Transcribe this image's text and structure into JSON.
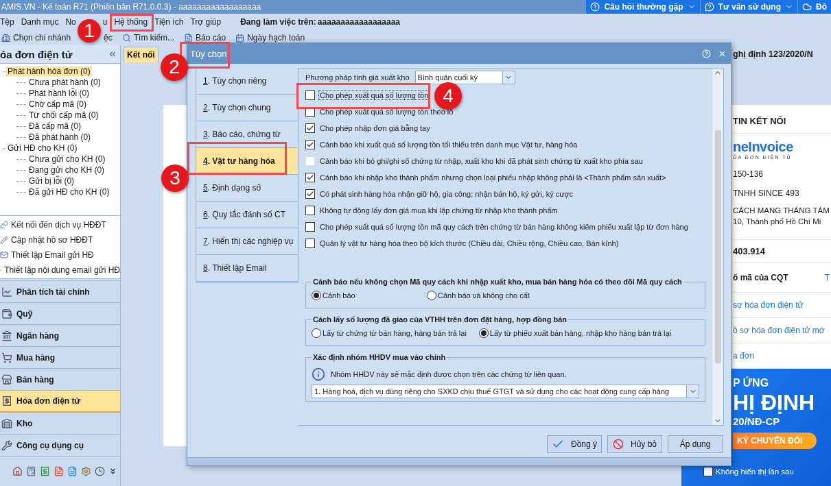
{
  "window": {
    "title": "AMIS.VN - Kế toán R71 (Phiên bản R71.0.0.3) - aaaaaaaaaaaaaaaaaa",
    "help_buttons": [
      {
        "label": "Câu hỏi thường gặp"
      },
      {
        "label": "Tư vấn sử dụng"
      },
      {
        "label": "Đô"
      }
    ]
  },
  "menu": {
    "items": [
      "Tệp",
      "Danh mục",
      "No",
      "u",
      "Hệ thống",
      "Tiện ích",
      "Trợ giúp"
    ],
    "workspace_label": "Đang làm việc trên:",
    "workspace": "aaaaaaaaaaaaaaaaaa"
  },
  "toolbar": [
    {
      "label": "Chọn chi nhánh"
    },
    {
      "label": "ệc"
    },
    {
      "label": "Tìm kiếm..."
    },
    {
      "label": "Báo cáo"
    },
    {
      "label": "Ngày hạch toán"
    }
  ],
  "sidebar": {
    "title": "óa đơn điện tử",
    "tree": [
      {
        "label": "Phát hành hóa đơn (0)",
        "selected": true,
        "children": [
          {
            "label": "Chưa phát hành (0)",
            "selected": false
          },
          {
            "label": "Phát hành lỗi (0)",
            "selected": false
          },
          {
            "label": "Chờ cấp mã (0)",
            "selected": false
          },
          {
            "label": "Từ chối cấp mã (0)",
            "selected": false
          },
          {
            "label": "Đã cấp mã (0)",
            "selected": false
          },
          {
            "label": "Đã phát hành (0)",
            "selected": false
          }
        ]
      },
      {
        "label": "Gửi HĐ cho KH (0)",
        "selected": false,
        "children": [
          {
            "label": "Chưa gửi cho KH (0)",
            "selected": false
          },
          {
            "label": "Đang gửi cho KH (0)",
            "selected": false
          },
          {
            "label": "Gửi bị lỗi (0)",
            "selected": false
          },
          {
            "label": "Đã gửi HĐ cho KH (0)",
            "selected": false
          }
        ]
      }
    ],
    "links": [
      "Kết nối đến dịch vụ HĐĐT",
      "Cập nhật hồ sơ HĐĐT",
      "Thiết lập Email gửi HĐ",
      "Thiết lập nội dung email gửi HĐ"
    ],
    "modules": [
      {
        "label": "Phân tích tài chính",
        "selected": false
      },
      {
        "label": "Quỹ",
        "selected": false
      },
      {
        "label": "Ngân hàng",
        "selected": false
      },
      {
        "label": "Mua hàng",
        "selected": false
      },
      {
        "label": "Bán hàng",
        "selected": false
      },
      {
        "label": "Hóa đơn điện tử",
        "selected": true
      },
      {
        "label": "Kho",
        "selected": false
      },
      {
        "label": "Công cụ dụng cụ",
        "selected": false
      }
    ]
  },
  "tab": {
    "label": "Kết nối",
    "selected": true
  },
  "connection_panel": {
    "heading": "ghị định 123/2020/N",
    "title": "TIN KẾT NỐI",
    "logo": "neInvoice",
    "logo_tagline": "ÓA ĐƠN ĐIỆN TỬ",
    "fields": [
      "150-136",
      "TNHH SINCE 493"
    ],
    "address_lines": [
      "CÁCH MẠNG THÁNG TÁM",
      "10, Thành phố Hồ Chí Mi"
    ],
    "amount": "403.914",
    "status_row": {
      "label": "ố mã của CQT",
      "link": "T"
    },
    "links": [
      "sơ hóa đơn điện tử",
      "ồ sơ hóa đơn điện tử mớ",
      "a đơn"
    ],
    "banner": {
      "lines": [
        "P ỨNG",
        "HỊ ĐỊNH",
        "20/NĐ-CP"
      ],
      "button": "KÝ CHUYỂN ĐỔI",
      "checkbox": {
        "label": "Không hiển thị lần sau",
        "checked": false
      }
    }
  },
  "dialog": {
    "title": "Tùy chọn",
    "nav": [
      {
        "label": "1. Tùy chọn riêng",
        "selected": false
      },
      {
        "label": "2. Tùy chọn chung",
        "selected": false
      },
      {
        "label": "3. Báo cáo, chứng từ",
        "selected": false
      },
      {
        "label": "4. Vật tư hàng hóa",
        "selected": true
      },
      {
        "label": "5. Định dạng số",
        "selected": false
      },
      {
        "label": "6. Quy tắc đánh số CT",
        "selected": false
      },
      {
        "label": "7. Hiển thị các nghiệp vụ",
        "selected": false
      },
      {
        "label": "8. Thiết lập Email",
        "selected": false
      }
    ],
    "costing": {
      "label": "Phương pháp tính giá xuất kho",
      "value": "Bình quân cuối kỳ"
    },
    "options": [
      {
        "label": "Cho phép xuất quá số lượng tồn",
        "checked": false,
        "disabled": false,
        "focused": true
      },
      {
        "label": "Cho phép xuất quá số lượng tồn theo lô",
        "checked": false,
        "disabled": false,
        "focused": false
      },
      {
        "label": "Cho phép nhập đơn giá bằng tay",
        "checked": true,
        "disabled": false,
        "focused": false
      },
      {
        "label": "Cảnh báo khi xuất quá số lượng tồn tối thiểu trên danh mục Vật tư, hàng hóa",
        "checked": true,
        "disabled": false,
        "focused": false
      },
      {
        "label": "Cảnh báo khi bỏ ghi/ghi sổ chứng từ nhập, xuất kho khi đã phát sinh chứng từ xuất kho phía sau",
        "checked": false,
        "disabled": true,
        "focused": false
      },
      {
        "label": "Cảnh báo khi nhập kho thành phẩm nhưng chọn loại phiếu nhập không phải là <Thành phẩm sản xuất>",
        "checked": true,
        "disabled": false,
        "focused": false
      },
      {
        "label": "Có phát sinh hàng hóa nhận giữ hộ, gia công; nhận bán hộ, ký gửi, ký cược",
        "checked": true,
        "disabled": false,
        "focused": false
      },
      {
        "label": "Không tự động lấy đơn giá mua khi lập chứng từ nhập kho thành phẩm",
        "checked": false,
        "disabled": false,
        "focused": false
      },
      {
        "label": "Cho phép xuất quá số lượng tồn mã quy cách trên chứng từ bán hàng không kiêm phiếu xuất lập từ đơn hàng",
        "checked": false,
        "disabled": false,
        "focused": false
      },
      {
        "label": "Quản lý vật tư hàng hóa theo bộ kích thước (Chiều dài, Chiều rộng, Chiều cao, Bán kính)",
        "checked": false,
        "disabled": false,
        "focused": false
      }
    ],
    "groups": [
      {
        "kind": "radio",
        "title": "Cảnh báo nếu không chọn Mã quy cách khi nhập xuất kho, mua bán hàng hóa có theo dõi Mã quy cách",
        "options": [
          {
            "label": "Cảnh báo",
            "selected": true
          },
          {
            "label": "Cảnh báo và không cho cất",
            "selected": false
          }
        ]
      },
      {
        "kind": "radio",
        "title": "Cách lấy số lượng đã giao của VTHH trên đơn đặt hàng, hợp đồng bán",
        "options": [
          {
            "label": "Lấy từ chứng từ bán hàng, hàng bán trả lại",
            "selected": false
          },
          {
            "label": "Lấy từ phiếu xuất bán hàng, nhập kho hàng bán trả lại",
            "selected": true
          }
        ]
      },
      {
        "kind": "select",
        "title": "Xác định nhóm HHDV mua vào chính",
        "note": "Nhóm HHDV này sẽ mặc định được chọn trên các chứng từ liên quan.",
        "value": "1. Hàng hoá, dịch vụ dùng riêng cho SXKD chịu thuế GTGT và sử dụng cho các hoạt động cung cấp hàng"
      }
    ],
    "buttons": [
      {
        "kind": "ok",
        "label": "Đồng ý"
      },
      {
        "kind": "cancel",
        "label": "Hủy bỏ"
      },
      {
        "kind": "apply",
        "label": "Áp dụng"
      }
    ]
  },
  "callouts": [
    {
      "label": "1"
    },
    {
      "label": "2"
    },
    {
      "label": "3"
    },
    {
      "label": "4"
    }
  ]
}
